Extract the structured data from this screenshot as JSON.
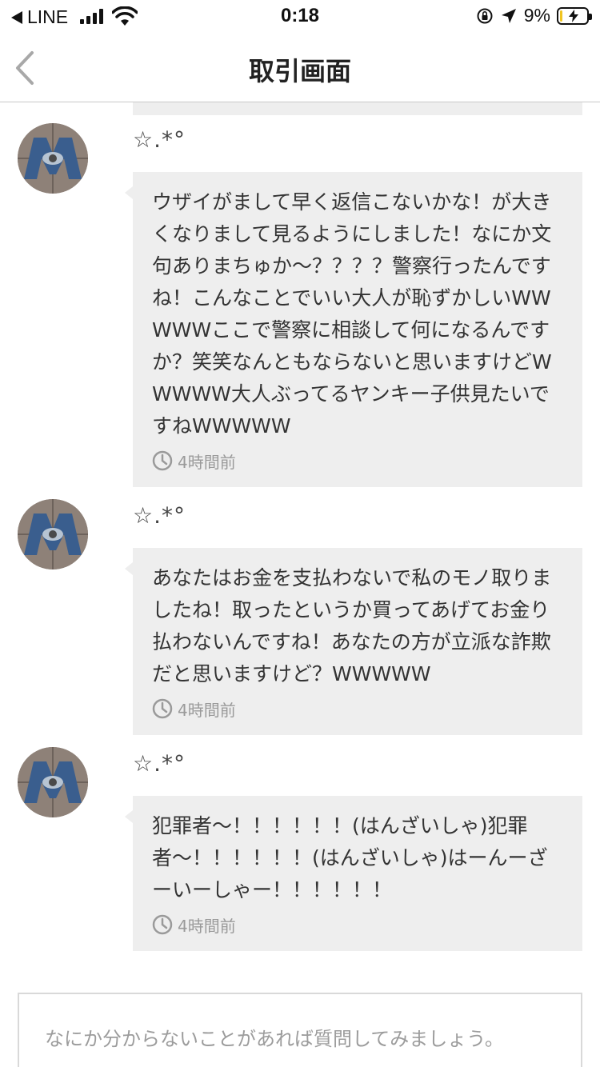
{
  "status_bar": {
    "back_app": "LINE",
    "time": "0:18",
    "battery_percent": "9%",
    "battery_level": 0.09,
    "icons": [
      "back-arrow-icon",
      "signal-icon",
      "wifi-icon",
      "orientation-lock-icon",
      "location-arrow-icon",
      "battery-charging-icon"
    ]
  },
  "nav": {
    "title": "取引画面",
    "back_icon": "chevron-left-icon"
  },
  "messages": [
    {
      "username": "☆.*°",
      "text": "ウザイがまして早く返信こないかな！が大きくなりまして見るようにしました！なにか文句ありまちゅか〜？？？？警察行ったんですね！こんなことでいい大人が恥ずかしいWWWWWここで警察に相談して何になるんですか？笑笑なんともならないと思いますけどWWWWW大人ぶってるヤンキー子供見たいですねWWWWW",
      "time": "4時間前"
    },
    {
      "username": "☆.*°",
      "text": "あなたはお金を支払わないで私のモノ取りましたね！取ったというか買ってあげてお金り払わないんですね！あなたの方が立派な詐欺だと思いますけど？WWWWW",
      "time": "4時間前"
    },
    {
      "username": "☆.*°",
      "text": "犯罪者〜！！！！！！(はんざいしゃ)犯罪者〜！！！！！！(はんざいしゃ)はーんーざーいーしゃー！！！！！！",
      "time": "4時間前"
    }
  ],
  "input": {
    "placeholder": "なにか分からないことがあれば質問してみましょう。",
    "value": ""
  },
  "colors": {
    "bubble": "#eeeeee",
    "text": "#333333",
    "muted": "#9a9a9a",
    "border": "#c8c8c8"
  }
}
